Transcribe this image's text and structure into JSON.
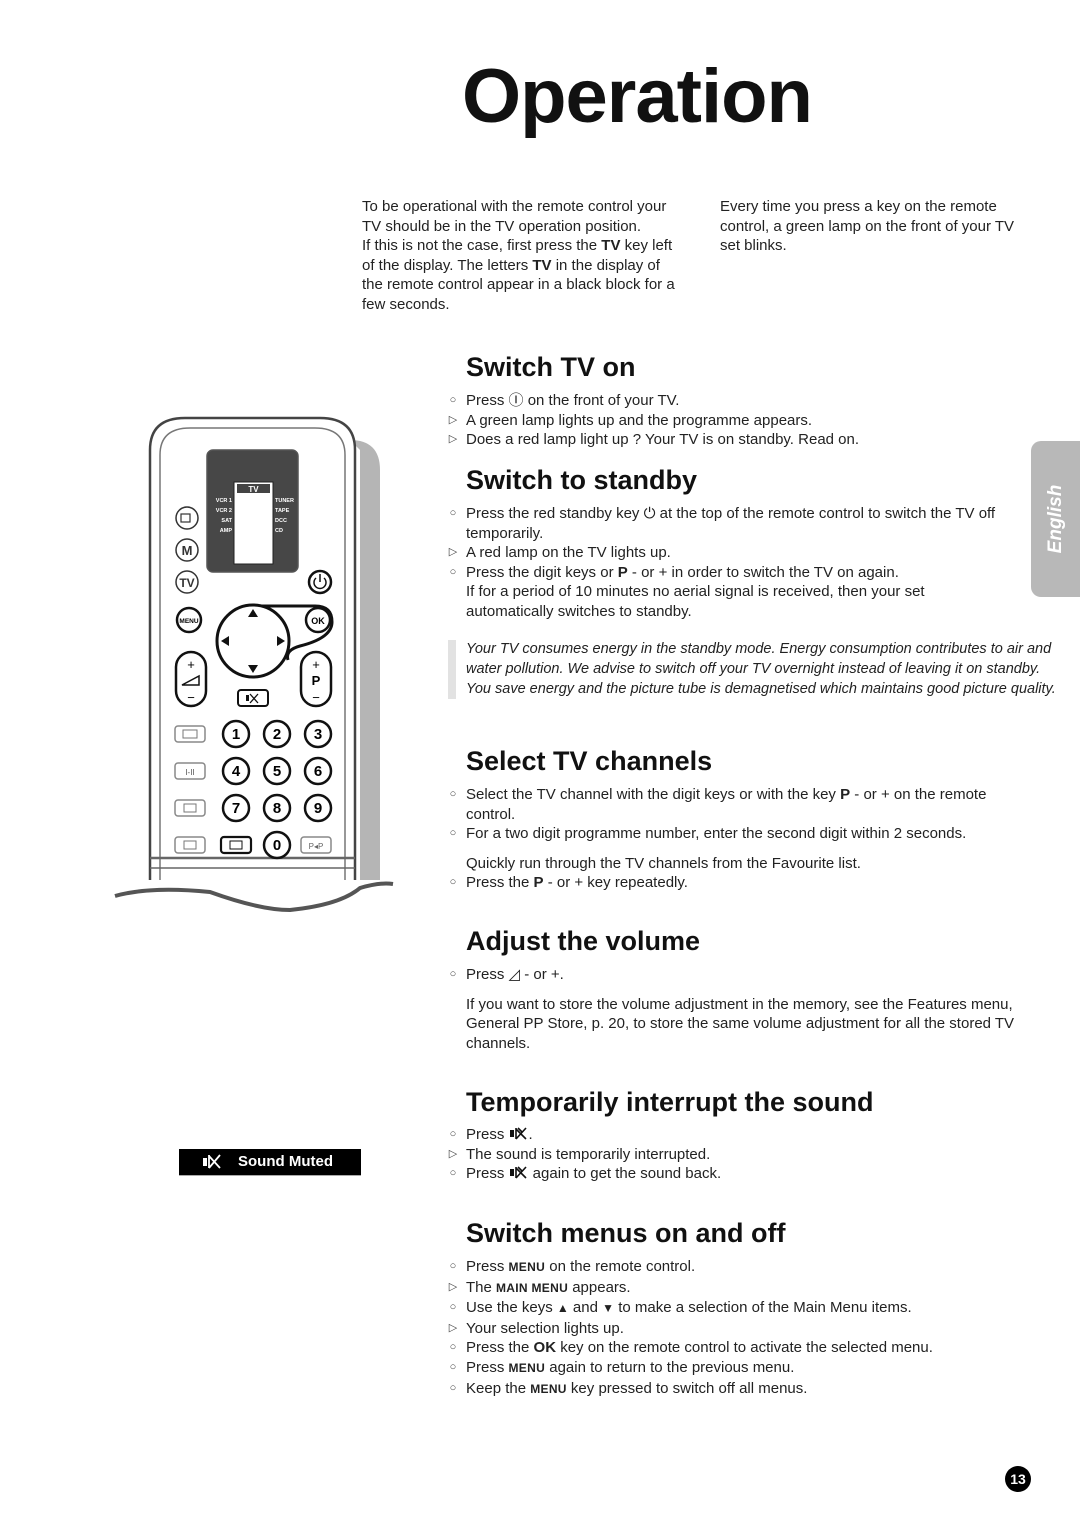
{
  "page": {
    "title": "Operation",
    "page_number": "13",
    "language_tab": "English"
  },
  "intro": {
    "left": {
      "p1": "To be operational with the remote control your TV should be in the TV operation position.",
      "p2_a": "If this is not the case, first press the ",
      "p2_b": "TV",
      "p2_c": " key left of the display. The letters ",
      "p2_d": "TV",
      "p2_e": " in the display of the remote control appear in a black block for a few seconds."
    },
    "right": "Every time you press a key on the remote control, a green lamp on the front of your TV set blinks."
  },
  "sections": {
    "switch_on": {
      "heading": "Switch TV on",
      "items": [
        {
          "a": "Press ",
          "icon": "Ⓘ",
          "b": " on the front of your TV."
        },
        {
          "text": "A green lamp lights up and the programme appears."
        },
        {
          "text": "Does a red lamp light up ? Your TV is on standby. Read on."
        }
      ]
    },
    "standby": {
      "heading": "Switch to standby",
      "items": [
        {
          "a": "Press the red standby key ",
          "icon": "⏻",
          "b": " at the top of the remote control to switch the TV off temporarily."
        },
        {
          "text": "A red lamp on the TV lights up."
        },
        {
          "a": "Press the digit keys or ",
          "bold": "P",
          "b": " - or +  in order to switch the TV on again."
        },
        {
          "text": "If for a period of 10 minutes no aerial signal is received, then your set automatically switches to standby."
        }
      ],
      "note": "Your TV consumes energy in the standby mode. Energy consumption contributes to air and water pollution. We advise to switch off your TV overnight instead of leaving it on standby. You save energy and the picture tube is demagnetised which maintains good picture quality."
    },
    "channels": {
      "heading": "Select TV channels",
      "items": [
        {
          "a": "Select the TV channel with the digit keys or with the key ",
          "bold": "P",
          "b": " - or + on the remote control."
        },
        {
          "text": "For a two digit programme number, enter the second digit within 2 seconds."
        },
        {
          "text": "Quickly run through the TV channels from the Favourite list."
        },
        {
          "a": "Press the ",
          "bold": "P",
          "b": " - or + key repeatedly."
        }
      ]
    },
    "volume": {
      "heading": "Adjust the volume",
      "items": [
        {
          "a": "Press ",
          "icon": "◿",
          "b": " - or +."
        },
        {
          "text": "If you want to store the volume adjustment in the memory, see the Features menu, General PP Store, p. 20, to store the same volume adjustment for all the stored TV channels."
        }
      ]
    },
    "sound": {
      "heading": "Temporarily interrupt the sound",
      "items": [
        {
          "a": "Press ",
          "icon": "mute",
          "b": "."
        },
        {
          "text": "The sound is temporarily interrupted."
        },
        {
          "a": "Press ",
          "icon": "mute",
          "b": " again to get the sound back."
        }
      ],
      "osd_label": "Sound Muted"
    },
    "menus": {
      "heading": "Switch menus on and off",
      "items": [
        {
          "a": "Press ",
          "sc": "MENU",
          "b": " on the remote control."
        },
        {
          "a": "The ",
          "sc": "MAIN MENU",
          "b": " appears."
        },
        {
          "a": "Use the keys ",
          "up": "▲",
          "mid": " and ",
          "down": "▼",
          "b": " to make a selection of the Main Menu items."
        },
        {
          "text": "Your selection lights up."
        },
        {
          "a": "Press the ",
          "bold": "OK",
          "b": " key on the remote control to activate the selected menu."
        },
        {
          "a": "Press ",
          "sc": "MENU",
          "b": " again to return to the previous menu."
        },
        {
          "a": "Keep the ",
          "sc": "MENU",
          "b": " key pressed to switch off all menus."
        }
      ]
    }
  },
  "markers": {
    "bullet": "○",
    "result": "▷"
  },
  "remote": {
    "display_mode": "TV",
    "display_left": [
      "VCR 1",
      "VCR 2",
      "SAT",
      "AMP"
    ],
    "display_right": [
      "TUNER",
      "TAPE",
      "DCC",
      "CD"
    ],
    "keys": {
      "m": "M",
      "tv": "TV",
      "menu": "MENU",
      "ok": "OK",
      "p": "P",
      "digits": [
        "1",
        "2",
        "3",
        "4",
        "5",
        "6",
        "7",
        "8",
        "9",
        "0"
      ],
      "ii": "I-II",
      "pp": "P◂P",
      "plus": "+",
      "minus": "−"
    }
  }
}
